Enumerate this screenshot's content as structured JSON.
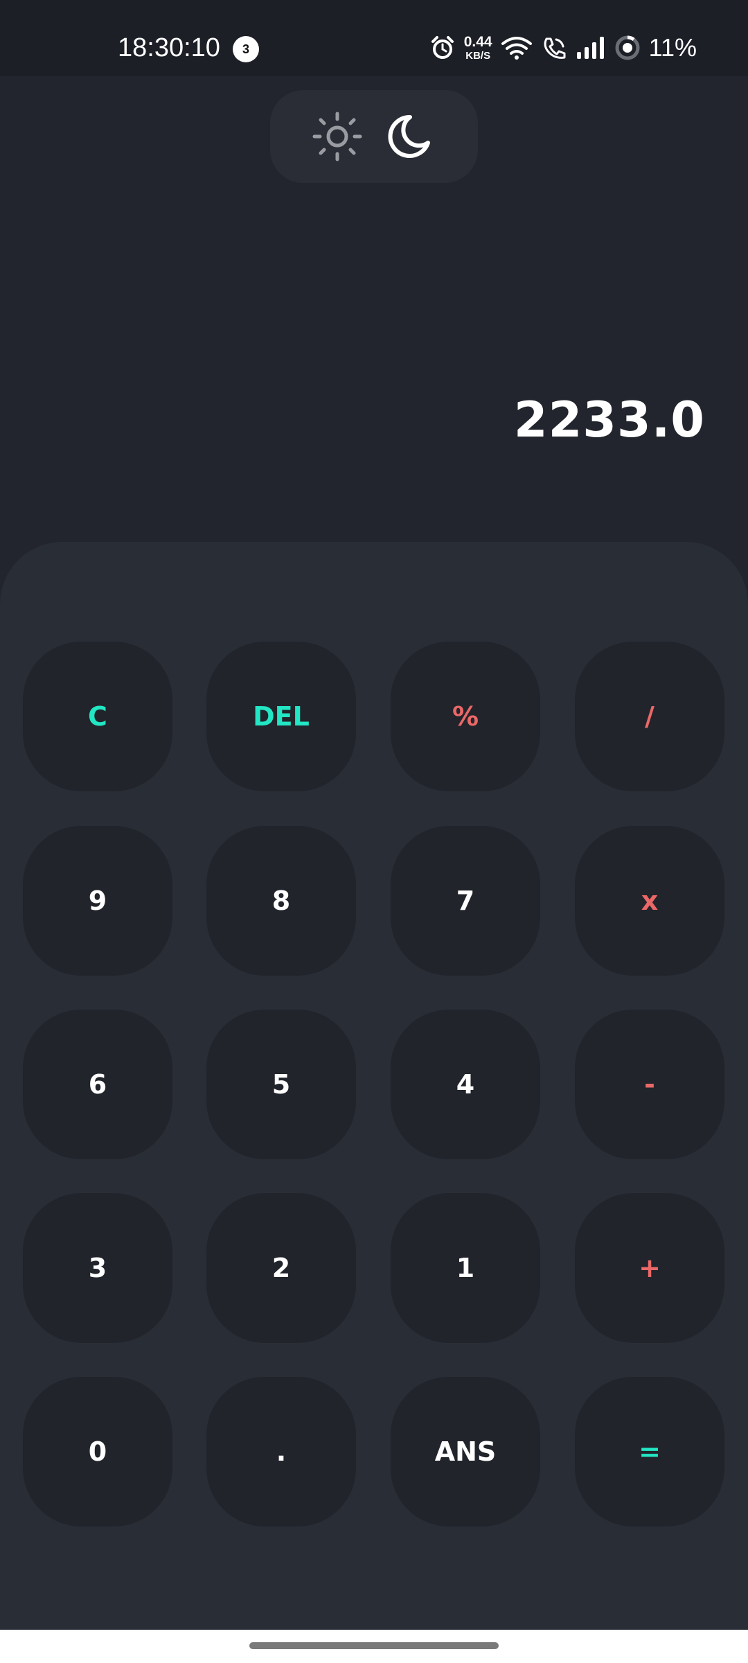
{
  "status_bar": {
    "time": "18:30:10",
    "notification_count": "3",
    "net_speed_value": "0.44",
    "net_speed_unit": "KB/S",
    "battery": "11%"
  },
  "theme_toggle": {
    "light_icon": "sun-icon",
    "dark_icon": "moon-icon",
    "active": "dark"
  },
  "display": {
    "result": "2233.0"
  },
  "keypad": {
    "rows": [
      [
        {
          "label": "C",
          "name": "clear-button",
          "color": "teal"
        },
        {
          "label": "DEL",
          "name": "delete-button",
          "color": "teal"
        },
        {
          "label": "%",
          "name": "percent-button",
          "color": "red"
        },
        {
          "label": "/",
          "name": "divide-button",
          "color": "red"
        }
      ],
      [
        {
          "label": "9",
          "name": "digit-9-button",
          "color": "white"
        },
        {
          "label": "8",
          "name": "digit-8-button",
          "color": "white"
        },
        {
          "label": "7",
          "name": "digit-7-button",
          "color": "white"
        },
        {
          "label": "x",
          "name": "multiply-button",
          "color": "red"
        }
      ],
      [
        {
          "label": "6",
          "name": "digit-6-button",
          "color": "white"
        },
        {
          "label": "5",
          "name": "digit-5-button",
          "color": "white"
        },
        {
          "label": "4",
          "name": "digit-4-button",
          "color": "white"
        },
        {
          "label": "-",
          "name": "subtract-button",
          "color": "red"
        }
      ],
      [
        {
          "label": "3",
          "name": "digit-3-button",
          "color": "white"
        },
        {
          "label": "2",
          "name": "digit-2-button",
          "color": "white"
        },
        {
          "label": "1",
          "name": "digit-1-button",
          "color": "white"
        },
        {
          "label": "+",
          "name": "add-button",
          "color": "red"
        }
      ],
      [
        {
          "label": "0",
          "name": "digit-0-button",
          "color": "white"
        },
        {
          "label": ".",
          "name": "decimal-button",
          "color": "white"
        },
        {
          "label": "ANS",
          "name": "answer-button",
          "color": "white"
        },
        {
          "label": "=",
          "name": "equals-button",
          "color": "teal"
        }
      ]
    ]
  },
  "colors": {
    "background": "#22252d",
    "keypad_bg": "#292d36",
    "key_bg": "#21242b",
    "accent_teal": "#22e6c4",
    "accent_red": "#ea6868",
    "text": "#ffffff"
  }
}
